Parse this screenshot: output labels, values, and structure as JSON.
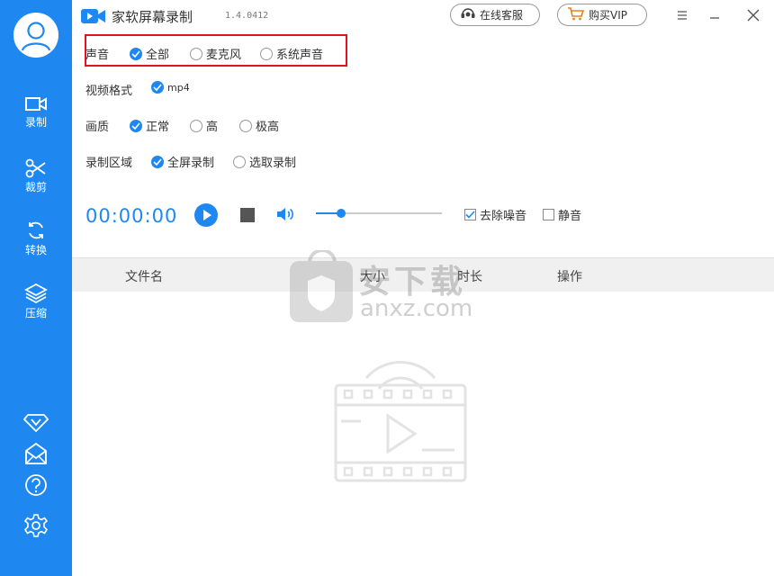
{
  "app": {
    "title": "家软屏幕录制",
    "version": "1.4.0412",
    "online_service": "在线客服",
    "buy_vip": "购买VIP"
  },
  "sidebar": {
    "items": [
      {
        "label": "录制",
        "icon": "video-camera-icon"
      },
      {
        "label": "裁剪",
        "icon": "scissors-icon"
      },
      {
        "label": "转换",
        "icon": "convert-icon"
      },
      {
        "label": "压缩",
        "icon": "layers-icon"
      }
    ],
    "bottom_icons": [
      "vip-diamond-icon",
      "mail-icon",
      "help-icon",
      "gear-icon"
    ]
  },
  "settings": {
    "audio": {
      "label": "声音",
      "options": [
        "全部",
        "麦克风",
        "系统声音"
      ],
      "selected": "全部"
    },
    "format": {
      "label": "视频格式",
      "options": [
        "mp4"
      ],
      "selected": "mp4"
    },
    "quality": {
      "label": "画质",
      "options": [
        "正常",
        "高",
        "极高"
      ],
      "selected": "正常"
    },
    "region": {
      "label": "录制区域",
      "options": [
        "全屏录制",
        "选取录制"
      ],
      "selected": "全屏录制"
    }
  },
  "controls": {
    "timer": "00:00:00",
    "volume_level": 0.2,
    "denoise_label": "去除噪音",
    "denoise_checked": true,
    "mute_label": "静音",
    "mute_checked": false
  },
  "table": {
    "columns": [
      "文件名",
      "大小",
      "时长",
      "操作"
    ],
    "rows": []
  },
  "watermark": {
    "text": "安下载",
    "domain": "anxz.com"
  },
  "colors": {
    "accent": "#1e88f0",
    "highlight": "#e0141e"
  }
}
